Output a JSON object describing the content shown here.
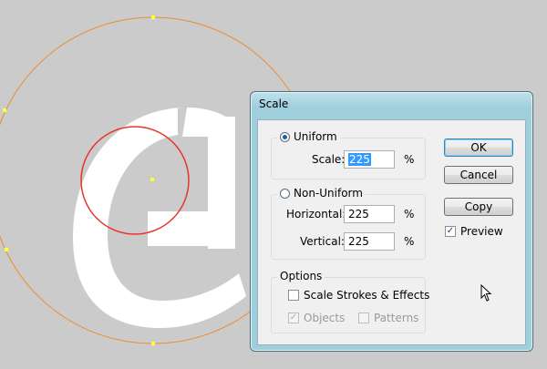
{
  "dialog": {
    "title": "Scale",
    "uniform_group": {
      "radio_label": "Uniform",
      "scale_label": "Scale:",
      "scale_value": "225",
      "unit": "%"
    },
    "nonuniform_group": {
      "radio_label": "Non-Uniform",
      "horizontal_label": "Horizontal:",
      "horizontal_value": "225",
      "vertical_label": "Vertical:",
      "vertical_value": "225",
      "unit": "%"
    },
    "options_group": {
      "legend": "Options",
      "scale_strokes_label": "Scale Strokes & Effects",
      "objects_label": "Objects",
      "patterns_label": "Patterns"
    },
    "buttons": {
      "ok": "OK",
      "cancel": "Cancel",
      "copy": "Copy"
    },
    "preview_label": "Preview"
  },
  "colors": {
    "selection": "#3399ff",
    "red_circle": "#e8332b",
    "orange_circle": "#f08a2a",
    "anchor": "#ffff33"
  },
  "glyph": "@"
}
